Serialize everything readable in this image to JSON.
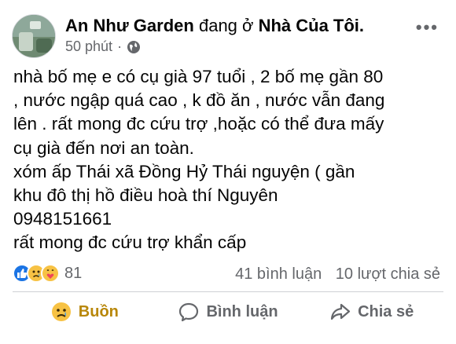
{
  "post": {
    "author": "An Như Garden",
    "action_text": "đang ở",
    "place": "Nhà Của Tôi.",
    "time": "50 phút",
    "separator": "·",
    "more_label": "•••",
    "lines": [
      "nhà bố mẹ e có cụ già 97 tuổi , 2 bố mẹ gần 80",
      ", nước ngập quá  cao , k đồ ăn , nước vẫn đang",
      "lên . rất mong đc cứu trợ ,hoặc có thể đưa mấy",
      "cụ già đến nơi an toàn.",
      "xóm ấp Thái xã Đồng Hỷ Thái nguyện ( gần",
      "khu đô thị hồ điều hoà thí Nguyên",
      "0948151661",
      "rất mong đc cứu trợ khẩn cấp"
    ]
  },
  "stats": {
    "reactions_count": "81",
    "comments": "41 bình luận",
    "shares": "10 lượt chia sẻ"
  },
  "actions": {
    "reaction_label": "Buồn",
    "comment_label": "Bình luận",
    "share_label": "Chia sẻ"
  },
  "colors": {
    "text": "#050505",
    "secondary": "#65676b",
    "like_blue": "#1b74e4",
    "reaction_yellow": "#f7c244",
    "sad_active": "#b8870a",
    "divider": "#ced0d4"
  },
  "icons": {
    "globe": "globe-icon",
    "more": "more-options-icon",
    "like": "like-reaction-icon",
    "sad": "sad-reaction-icon",
    "care": "care-reaction-icon",
    "sad_button": "sad-face-icon",
    "comment": "comment-icon",
    "share": "share-icon"
  }
}
